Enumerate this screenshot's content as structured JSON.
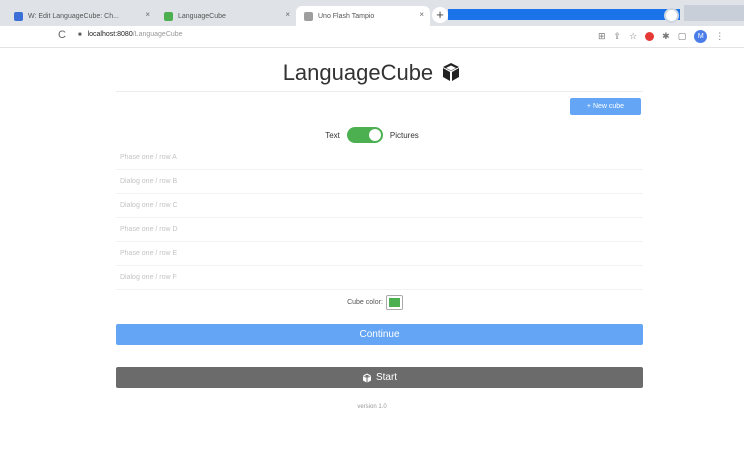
{
  "browser": {
    "tabs": [
      {
        "label": "W: Edit LanguageCube: Ch...",
        "favicon_color": "#3b6fd8"
      },
      {
        "label": "LanguageCube",
        "favicon_color": "#4caf50"
      },
      {
        "label": "Uno Flash Tampio",
        "favicon_color": "#9e9e9e"
      }
    ],
    "tab_close_glyph": "×",
    "new_tab_glyph": "+",
    "reload_glyph": "C",
    "lock_glyph": "■",
    "url_host": "localhost:8080",
    "url_path": "/LanguageCube",
    "toolbar_icons": [
      "translate-icon",
      "share-icon",
      "star-icon",
      "extension-red-icon",
      "puzzle-icon",
      "sidebar-icon",
      "profile-icon",
      "menu-icon"
    ],
    "toolbar_glyphs": {
      "translate": "⊞",
      "share": "⇪",
      "star": "☆",
      "puzzle": "✱",
      "sidebar": "▢",
      "menu": "⋮"
    },
    "profile_initial": "M"
  },
  "page": {
    "title": "LanguageCube",
    "new_cube_button": "+ New cube",
    "toggle": {
      "left_label": "Text",
      "right_label": "Pictures",
      "on": true
    },
    "rows": [
      "Phase one / row A",
      "Dialog one / row B",
      "Dialog one / row C",
      "Phase one / row D",
      "Phase one / row E",
      "Dialog one / row F"
    ],
    "cube_color_label": "Cube color:",
    "cube_color": "#4caf50",
    "continue_button": "Continue",
    "start_button": "Start",
    "version": "version 1.0"
  },
  "colors": {
    "accent_blue": "#64a6f5",
    "start_gray": "#6b6b6b",
    "toggle_green": "#4caf50"
  }
}
